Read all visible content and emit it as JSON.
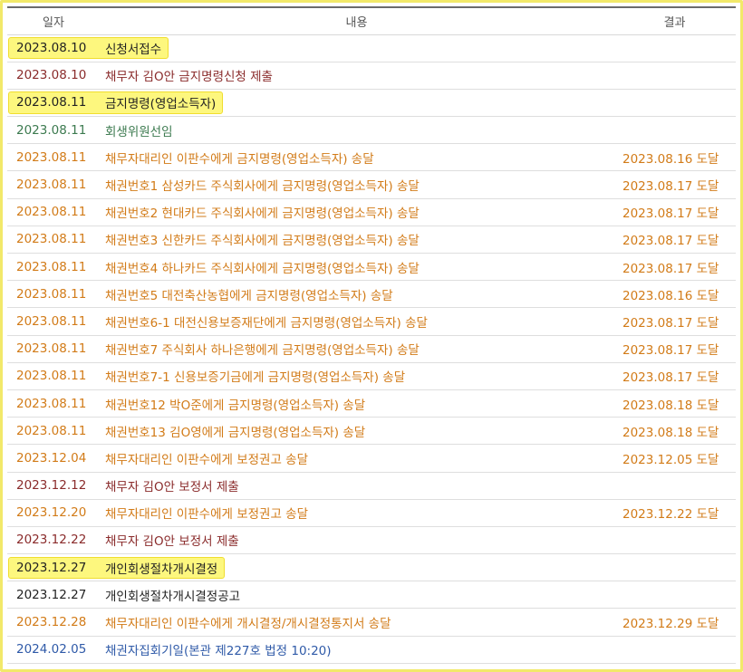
{
  "headers": {
    "date": "일자",
    "content": "내용",
    "result": "결과"
  },
  "rows": [
    {
      "date": "2023.08.10",
      "content": "신청서접수",
      "result": "",
      "tone": "black",
      "highlight": true
    },
    {
      "date": "2023.08.10",
      "content": "채무자 김O안 금지명령신청 제출",
      "result": "",
      "tone": "maroon",
      "highlight": false
    },
    {
      "date": "2023.08.11",
      "content": "금지명령(영업소득자)",
      "result": "",
      "tone": "black",
      "highlight": true
    },
    {
      "date": "2023.08.11",
      "content": "회생위원선임",
      "result": "",
      "tone": "green",
      "highlight": false
    },
    {
      "date": "2023.08.11",
      "content": "채무자대리인 이판수에게 금지명령(영업소득자) 송달",
      "result": "2023.08.16 도달",
      "tone": "orange",
      "highlight": false
    },
    {
      "date": "2023.08.11",
      "content": "채권번호1 삼성카드 주식회사에게 금지명령(영업소득자) 송달",
      "result": "2023.08.17 도달",
      "tone": "orange",
      "highlight": false
    },
    {
      "date": "2023.08.11",
      "content": "채권번호2 현대카드 주식회사에게 금지명령(영업소득자) 송달",
      "result": "2023.08.17 도달",
      "tone": "orange",
      "highlight": false
    },
    {
      "date": "2023.08.11",
      "content": "채권번호3 신한카드 주식회사에게 금지명령(영업소득자) 송달",
      "result": "2023.08.17 도달",
      "tone": "orange",
      "highlight": false
    },
    {
      "date": "2023.08.11",
      "content": "채권번호4 하나카드 주식회사에게 금지명령(영업소득자) 송달",
      "result": "2023.08.17 도달",
      "tone": "orange",
      "highlight": false
    },
    {
      "date": "2023.08.11",
      "content": "채권번호5 대전축산농협에게 금지명령(영업소득자) 송달",
      "result": "2023.08.16 도달",
      "tone": "orange",
      "highlight": false
    },
    {
      "date": "2023.08.11",
      "content": "채권번호6-1 대전신용보증재단에게 금지명령(영업소득자) 송달",
      "result": "2023.08.17 도달",
      "tone": "orange",
      "highlight": false
    },
    {
      "date": "2023.08.11",
      "content": "채권번호7 주식회사 하나은행에게 금지명령(영업소득자) 송달",
      "result": "2023.08.17 도달",
      "tone": "orange",
      "highlight": false
    },
    {
      "date": "2023.08.11",
      "content": "채권번호7-1 신용보증기금에게 금지명령(영업소득자) 송달",
      "result": "2023.08.17 도달",
      "tone": "orange",
      "highlight": false
    },
    {
      "date": "2023.08.11",
      "content": "채권번호12 박O준에게 금지명령(영업소득자) 송달",
      "result": "2023.08.18 도달",
      "tone": "orange",
      "highlight": false
    },
    {
      "date": "2023.08.11",
      "content": "채권번호13 김O영에게 금지명령(영업소득자) 송달",
      "result": "2023.08.18 도달",
      "tone": "orange",
      "highlight": false
    },
    {
      "date": "2023.12.04",
      "content": "채무자대리인 이판수에게 보정권고 송달",
      "result": "2023.12.05 도달",
      "tone": "orange",
      "highlight": false
    },
    {
      "date": "2023.12.12",
      "content": "채무자 김O안 보정서 제출",
      "result": "",
      "tone": "maroon",
      "highlight": false
    },
    {
      "date": "2023.12.20",
      "content": "채무자대리인 이판수에게 보정권고 송달",
      "result": "2023.12.22 도달",
      "tone": "orange",
      "highlight": false
    },
    {
      "date": "2023.12.22",
      "content": "채무자 김O안 보정서 제출",
      "result": "",
      "tone": "maroon",
      "highlight": false
    },
    {
      "date": "2023.12.27",
      "content": "개인회생절차개시결정",
      "result": "",
      "tone": "black",
      "highlight": true
    },
    {
      "date": "2023.12.27",
      "content": "개인회생절차개시결정공고",
      "result": "",
      "tone": "black",
      "highlight": false
    },
    {
      "date": "2023.12.28",
      "content": "채무자대리인 이판수에게 개시결정/개시결정통지서 송달",
      "result": "2023.12.29 도달",
      "tone": "orange",
      "highlight": false
    },
    {
      "date": "2024.02.05",
      "content": "채권자집회기일(본관 제227호 법정 10:20)",
      "result": "",
      "tone": "blue",
      "highlight": false
    }
  ],
  "colors": {
    "black": "#222222",
    "maroon": "#8a2b2b",
    "green": "#3c7a4f",
    "orange": "#d27b18",
    "blue": "#2f5aa8",
    "highlight": "#fdf77e"
  }
}
